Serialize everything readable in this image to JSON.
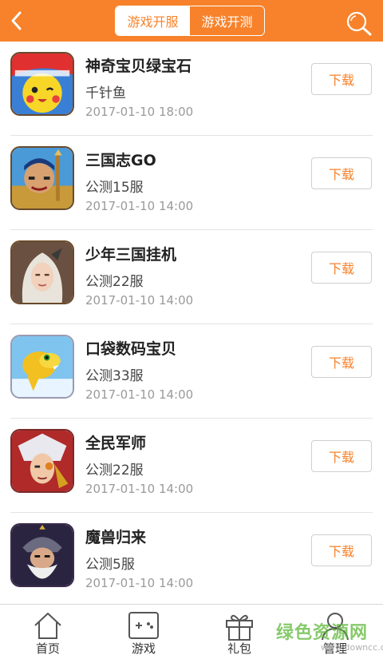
{
  "header": {
    "tabs": [
      {
        "label": "游戏开服",
        "active": true
      },
      {
        "label": "游戏开测",
        "active": false
      }
    ],
    "back_icon": "chevron-left-icon",
    "search_icon": "search-icon",
    "accent_color": "#f7822b"
  },
  "games": [
    {
      "name": "神奇宝贝绿宝石",
      "server": "千针鱼",
      "time": "2017-01-10 18:00",
      "button": "下载",
      "icon": "pikachu-game-icon"
    },
    {
      "name": "三国志GO",
      "server": "公测15服",
      "time": "2017-01-10 14:00",
      "button": "下载",
      "icon": "warrior-game-icon"
    },
    {
      "name": "少年三国挂机",
      "server": "公测22服",
      "time": "2017-01-10 14:00",
      "button": "下载",
      "icon": "heroine-game-icon"
    },
    {
      "name": "口袋数码宝贝",
      "server": "公测33服",
      "time": "2017-01-10 14:00",
      "button": "下载",
      "icon": "digimon-game-icon"
    },
    {
      "name": "全民军师",
      "server": "公测22服",
      "time": "2017-01-10 14:00",
      "button": "下载",
      "icon": "strategist-game-icon"
    },
    {
      "name": "魔兽归来",
      "server": "公测5服",
      "time": "2017-01-10 14:00",
      "button": "下载",
      "icon": "dwarf-game-icon"
    }
  ],
  "bottom_nav": [
    {
      "label": "首页",
      "icon": "home-icon"
    },
    {
      "label": "游戏",
      "icon": "gamepad-icon"
    },
    {
      "label": "礼包",
      "icon": "gift-icon"
    },
    {
      "label": "管理",
      "icon": "user-icon"
    }
  ],
  "watermark": {
    "text": "绿色资源网",
    "url": "www.downcc.com"
  }
}
